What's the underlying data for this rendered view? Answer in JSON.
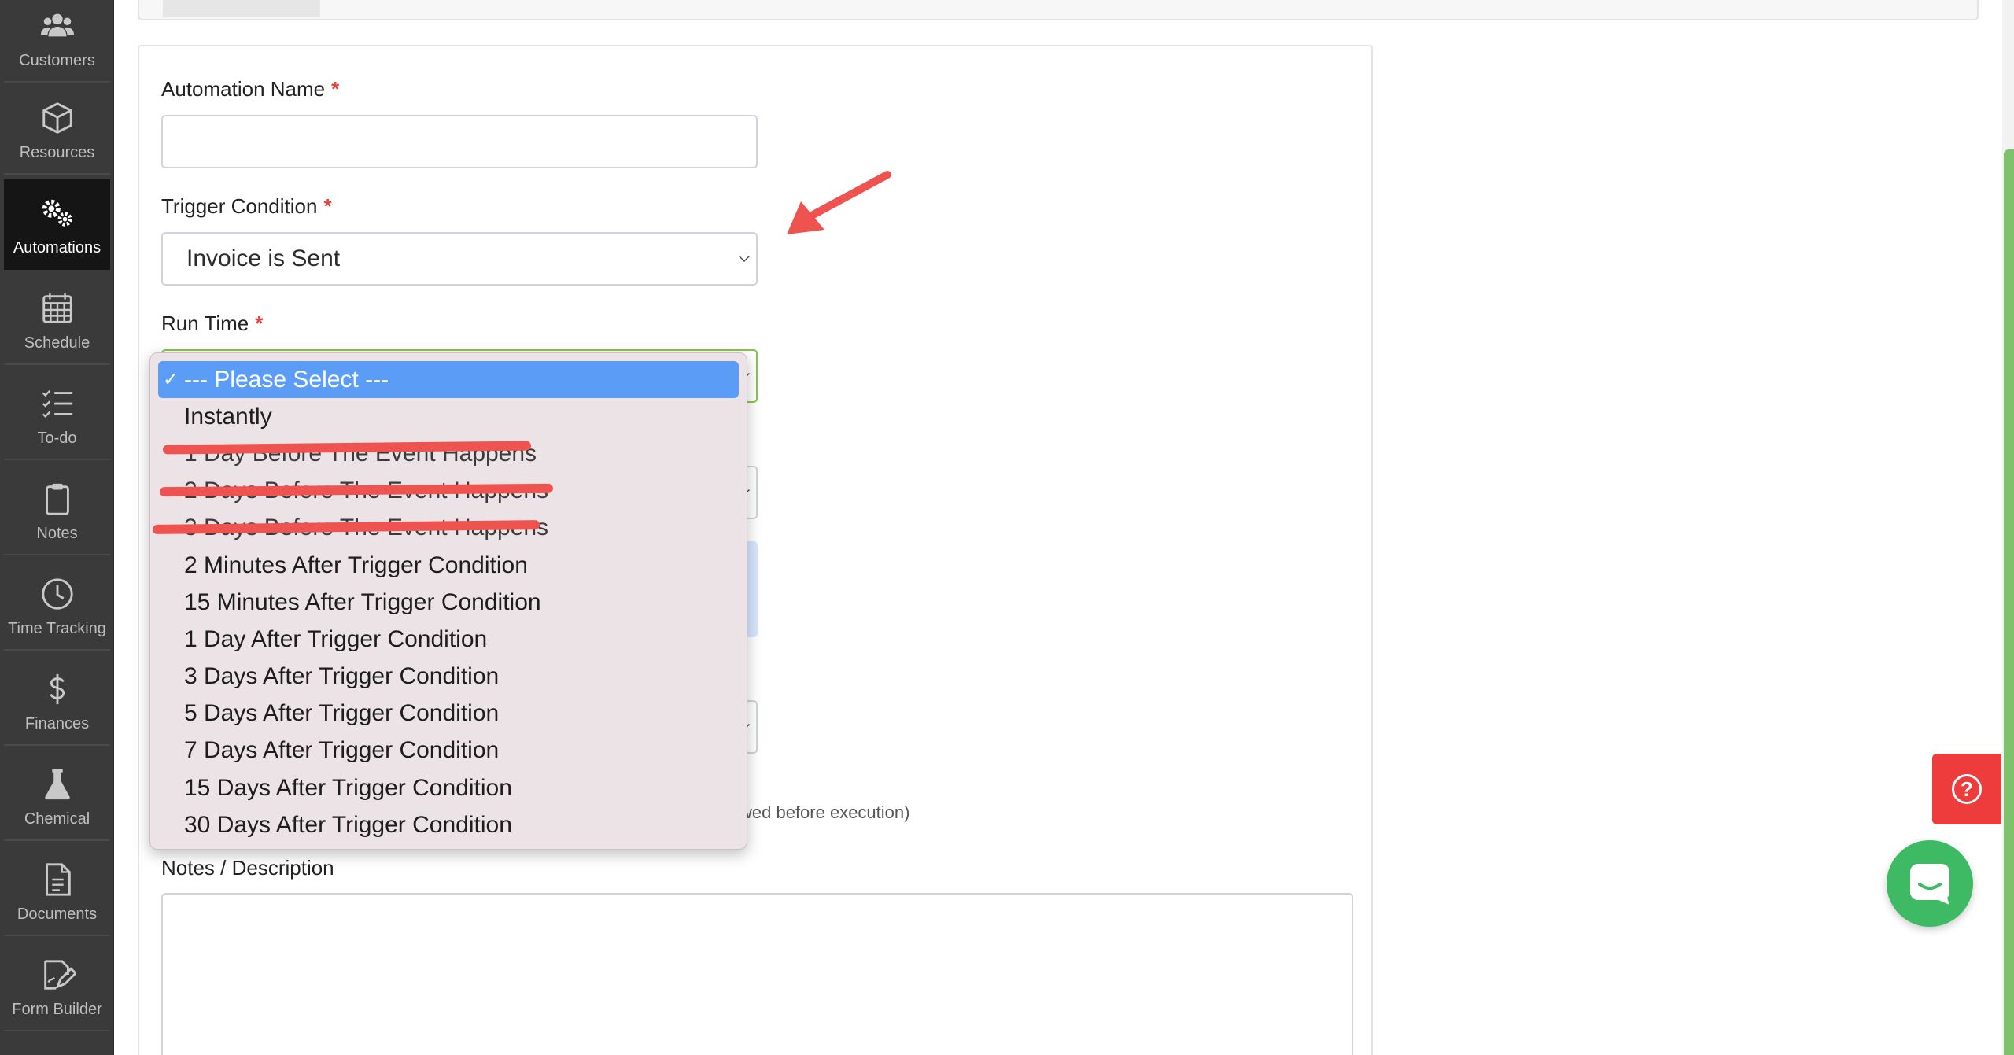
{
  "sidebar": {
    "items": [
      {
        "label": "Customers",
        "icon": "users-icon",
        "active": false
      },
      {
        "label": "Resources",
        "icon": "box-icon",
        "active": false
      },
      {
        "label": "Automations",
        "icon": "gears-icon",
        "active": true
      },
      {
        "label": "Schedule",
        "icon": "calendar-icon",
        "active": false
      },
      {
        "label": "To-do",
        "icon": "checklist-icon",
        "active": false
      },
      {
        "label": "Notes",
        "icon": "clipboard-icon",
        "active": false
      },
      {
        "label": "Time Tracking",
        "icon": "clock-icon",
        "active": false
      },
      {
        "label": "Finances",
        "icon": "dollar-icon",
        "active": false
      },
      {
        "label": "Chemical",
        "icon": "flask-icon",
        "active": false
      },
      {
        "label": "Documents",
        "icon": "document-icon",
        "active": false
      },
      {
        "label": "Form Builder",
        "icon": "form-edit-icon",
        "active": false
      }
    ]
  },
  "form": {
    "name_label": "Automation Name",
    "trigger_label": "Trigger Condition",
    "trigger_value": "Invoice is Sent",
    "runtime_label": "Run Time",
    "required_marker": "*",
    "notes_label": "Notes / Description",
    "partial_help": "wed before execution)"
  },
  "runtime_dropdown": {
    "selected_check": "✓",
    "options": [
      {
        "label": "--- Please Select ---",
        "selected": true,
        "struck": false
      },
      {
        "label": "Instantly",
        "selected": false,
        "struck": false
      },
      {
        "label": "1 Day Before The Event Happens",
        "selected": false,
        "struck": true
      },
      {
        "label": "2 Days Before The Event Happens",
        "selected": false,
        "struck": true
      },
      {
        "label": "3 Days Before The Event Happens",
        "selected": false,
        "struck": true
      },
      {
        "label": "2 Minutes After Trigger Condition",
        "selected": false,
        "struck": false
      },
      {
        "label": "15 Minutes After Trigger Condition",
        "selected": false,
        "struck": false
      },
      {
        "label": "1 Day After Trigger Condition",
        "selected": false,
        "struck": false
      },
      {
        "label": "3 Days After Trigger Condition",
        "selected": false,
        "struck": false
      },
      {
        "label": "5 Days After Trigger Condition",
        "selected": false,
        "struck": false
      },
      {
        "label": "7 Days After Trigger Condition",
        "selected": false,
        "struck": false
      },
      {
        "label": "15 Days After Trigger Condition",
        "selected": false,
        "struck": false
      },
      {
        "label": "30 Days After Trigger Condition",
        "selected": false,
        "struck": false
      }
    ]
  },
  "widgets": {
    "help_icon": "?",
    "chat_icon": "chat-icon"
  },
  "colors": {
    "accent_red": "#ee3b3b",
    "selected_blue": "#5b9cf6",
    "annotation_red": "#ef5350",
    "chat_green": "#3dba63"
  }
}
